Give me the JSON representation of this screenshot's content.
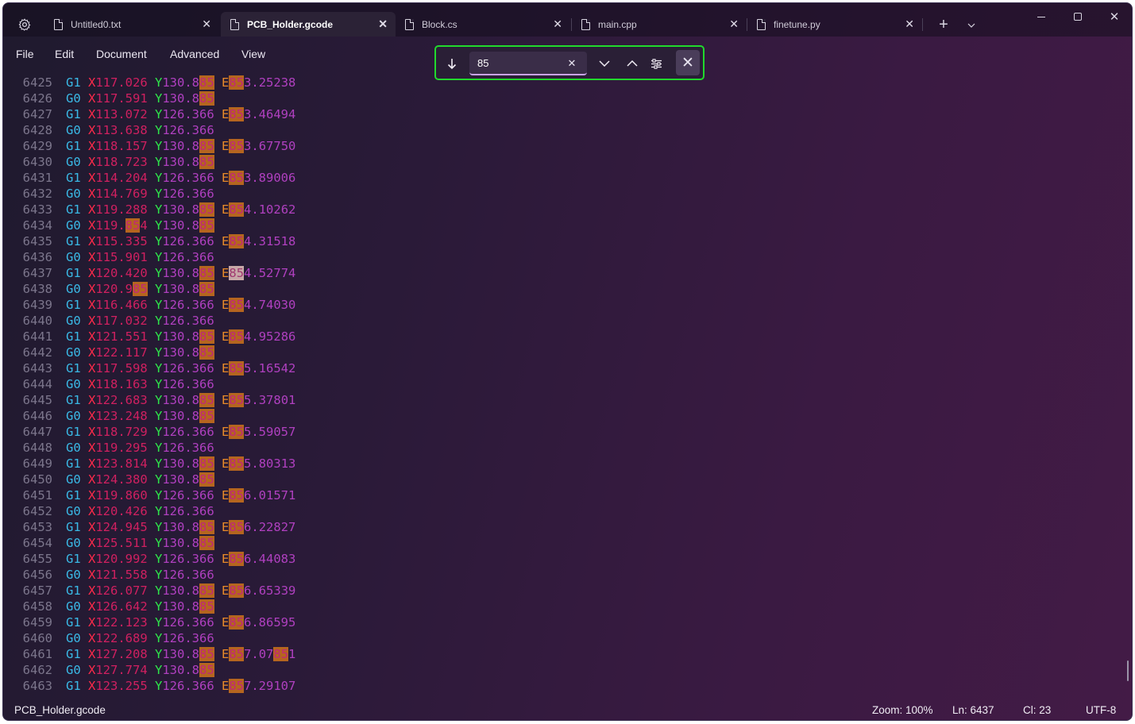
{
  "tabs": [
    {
      "label": "Untitled0.txt",
      "active": false
    },
    {
      "label": "PCB_Holder.gcode",
      "active": true
    },
    {
      "label": "Block.cs",
      "active": false
    },
    {
      "label": "main.cpp",
      "active": false
    },
    {
      "label": "finetune.py",
      "active": false
    }
  ],
  "menu": [
    "File",
    "Edit",
    "Document",
    "Advanced",
    "View"
  ],
  "find": {
    "query": "85"
  },
  "editor": {
    "lines": [
      {
        "n": "6425",
        "g": "G1",
        "x": "117.026",
        "y": "130.885",
        "e": "853.25238"
      },
      {
        "n": "6426",
        "g": "G0",
        "x": "117.591",
        "y": "130.885",
        "e": ""
      },
      {
        "n": "6427",
        "g": "G1",
        "x": "113.072",
        "y": "126.366",
        "e": "853.46494"
      },
      {
        "n": "6428",
        "g": "G0",
        "x": "113.638",
        "y": "126.366",
        "e": ""
      },
      {
        "n": "6429",
        "g": "G1",
        "x": "118.157",
        "y": "130.885",
        "e": "853.67750"
      },
      {
        "n": "6430",
        "g": "G0",
        "x": "118.723",
        "y": "130.885",
        "e": ""
      },
      {
        "n": "6431",
        "g": "G1",
        "x": "114.204",
        "y": "126.366",
        "e": "853.89006"
      },
      {
        "n": "6432",
        "g": "G0",
        "x": "114.769",
        "y": "126.366",
        "e": ""
      },
      {
        "n": "6433",
        "g": "G1",
        "x": "119.288",
        "y": "130.885",
        "e": "854.10262"
      },
      {
        "n": "6434",
        "g": "G0",
        "x": "119.854",
        "y": "130.885",
        "e": ""
      },
      {
        "n": "6435",
        "g": "G1",
        "x": "115.335",
        "y": "126.366",
        "e": "854.31518"
      },
      {
        "n": "6436",
        "g": "G0",
        "x": "115.901",
        "y": "126.366",
        "e": ""
      },
      {
        "n": "6437",
        "g": "G1",
        "x": "120.420",
        "y": "130.885",
        "e": "854.52774"
      },
      {
        "n": "6438",
        "g": "G0",
        "x": "120.985",
        "y": "130.885",
        "e": ""
      },
      {
        "n": "6439",
        "g": "G1",
        "x": "116.466",
        "y": "126.366",
        "e": "854.74030"
      },
      {
        "n": "6440",
        "g": "G0",
        "x": "117.032",
        "y": "126.366",
        "e": ""
      },
      {
        "n": "6441",
        "g": "G1",
        "x": "121.551",
        "y": "130.885",
        "e": "854.95286"
      },
      {
        "n": "6442",
        "g": "G0",
        "x": "122.117",
        "y": "130.885",
        "e": ""
      },
      {
        "n": "6443",
        "g": "G1",
        "x": "117.598",
        "y": "126.366",
        "e": "855.16542"
      },
      {
        "n": "6444",
        "g": "G0",
        "x": "118.163",
        "y": "126.366",
        "e": ""
      },
      {
        "n": "6445",
        "g": "G1",
        "x": "122.683",
        "y": "130.885",
        "e": "855.37801"
      },
      {
        "n": "6446",
        "g": "G0",
        "x": "123.248",
        "y": "130.885",
        "e": ""
      },
      {
        "n": "6447",
        "g": "G1",
        "x": "118.729",
        "y": "126.366",
        "e": "855.59057"
      },
      {
        "n": "6448",
        "g": "G0",
        "x": "119.295",
        "y": "126.366",
        "e": ""
      },
      {
        "n": "6449",
        "g": "G1",
        "x": "123.814",
        "y": "130.885",
        "e": "855.80313"
      },
      {
        "n": "6450",
        "g": "G0",
        "x": "124.380",
        "y": "130.885",
        "e": ""
      },
      {
        "n": "6451",
        "g": "G1",
        "x": "119.860",
        "y": "126.366",
        "e": "856.01571"
      },
      {
        "n": "6452",
        "g": "G0",
        "x": "120.426",
        "y": "126.366",
        "e": ""
      },
      {
        "n": "6453",
        "g": "G1",
        "x": "124.945",
        "y": "130.885",
        "e": "856.22827"
      },
      {
        "n": "6454",
        "g": "G0",
        "x": "125.511",
        "y": "130.885",
        "e": ""
      },
      {
        "n": "6455",
        "g": "G1",
        "x": "120.992",
        "y": "126.366",
        "e": "856.44083"
      },
      {
        "n": "6456",
        "g": "G0",
        "x": "121.558",
        "y": "126.366",
        "e": ""
      },
      {
        "n": "6457",
        "g": "G1",
        "x": "126.077",
        "y": "130.885",
        "e": "856.65339"
      },
      {
        "n": "6458",
        "g": "G0",
        "x": "126.642",
        "y": "130.885",
        "e": ""
      },
      {
        "n": "6459",
        "g": "G1",
        "x": "122.123",
        "y": "126.366",
        "e": "856.86595"
      },
      {
        "n": "6460",
        "g": "G0",
        "x": "122.689",
        "y": "126.366",
        "e": ""
      },
      {
        "n": "6461",
        "g": "G1",
        "x": "127.208",
        "y": "130.885",
        "e": "857.07851"
      },
      {
        "n": "6462",
        "g": "G0",
        "x": "127.774",
        "y": "130.885",
        "e": ""
      },
      {
        "n": "6463",
        "g": "G1",
        "x": "123.255",
        "y": "126.366",
        "e": "857.29107"
      }
    ]
  },
  "status": {
    "filename": "PCB_Holder.gcode",
    "zoom": "Zoom: 100%",
    "line": "Ln: 6437",
    "col": "Cl: 23",
    "encoding": "UTF-8"
  },
  "colors": {
    "find_border": "#21d92d",
    "highlight": "#b5651f",
    "g_token": "#3ab9e6",
    "x_token": "#ff2a4a",
    "y_token": "#2ee64a"
  },
  "icons": [
    "gear-icon",
    "file-icon",
    "close-icon",
    "plus-icon",
    "chevron-down-icon",
    "minimize-icon",
    "maximize-icon",
    "arrow-down-icon",
    "chevron-up-icon",
    "options-icon"
  ]
}
